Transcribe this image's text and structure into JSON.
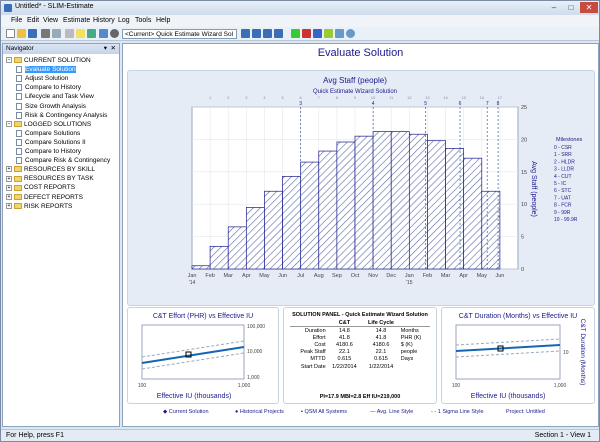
{
  "window": {
    "title": "Untitled* - SLIM-Estimate",
    "controls": [
      "–",
      "□",
      "✕"
    ]
  },
  "menu": [
    "File",
    "Edit",
    "View",
    "Estimate",
    "History",
    "Log",
    "Tools",
    "Help"
  ],
  "toolbar": {
    "combo_value": "<Current> Quick Estimate Wizard Sol"
  },
  "navigator": {
    "title": "Navigator",
    "head_icons": [
      "▾",
      "✕"
    ],
    "tree": [
      {
        "label": "CURRENT SOLUTION",
        "type": "folder",
        "level": 0,
        "expanded": true
      },
      {
        "label": "Evaluate Solution",
        "type": "doc",
        "level": 1,
        "selected": true
      },
      {
        "label": "Adjust Solution",
        "type": "doc",
        "level": 1
      },
      {
        "label": "Compare to History",
        "type": "doc",
        "level": 1
      },
      {
        "label": "Lifecycle and Task View",
        "type": "doc",
        "level": 1
      },
      {
        "label": "Size Growth Analysis",
        "type": "doc",
        "level": 1
      },
      {
        "label": "Risk & Contingency Analysis",
        "type": "doc",
        "level": 1
      },
      {
        "label": "LOGGED SOLUTIONS",
        "type": "folder",
        "level": 0,
        "expanded": true
      },
      {
        "label": "Compare Solutions",
        "type": "doc",
        "level": 1
      },
      {
        "label": "Compare Solutions II",
        "type": "doc",
        "level": 1
      },
      {
        "label": "Compare to History",
        "type": "doc",
        "level": 1
      },
      {
        "label": "Compare Risk & Contingency",
        "type": "doc",
        "level": 1
      },
      {
        "label": "RESOURCES BY SKILL",
        "type": "folder",
        "level": 0
      },
      {
        "label": "RESOURCES BY TASK",
        "type": "folder",
        "level": 0
      },
      {
        "label": "COST REPORTS",
        "type": "folder",
        "level": 0
      },
      {
        "label": "DEFECT REPORTS",
        "type": "folder",
        "level": 0
      },
      {
        "label": "RISK REPORTS",
        "type": "folder",
        "level": 0
      }
    ]
  },
  "main": {
    "title": "Evaluate Solution",
    "staff_chart": {
      "title": "Avg Staff (people)",
      "subtitle": "Quick Estimate Wizard Solution",
      "y_label": "Avg Staff (people)",
      "milestones_title": "Milestones",
      "milestones": [
        "0 - CSR",
        "1 - SRR",
        "2 - HLDR",
        "3 - LLDR",
        "4 - CUT",
        "5 - IC",
        "6 - STC",
        "7 - UAT",
        "8 - FCR",
        "9 - 99R",
        "10 - 99.9R"
      ],
      "milestone_markers": [
        {
          "label": "3",
          "x": 6.0
        },
        {
          "label": "4",
          "x": 10.0
        },
        {
          "label": "5",
          "x": 12.9
        },
        {
          "label": "6",
          "x": 14.8
        },
        {
          "label": "7",
          "x": 16.3
        },
        {
          "label": "8",
          "x": 16.9
        }
      ]
    },
    "effort_chart": {
      "title": "C&T Effort (PHR) vs Effective IU",
      "x_label": "Effective IU (thousands)",
      "x_ticks": [
        "100",
        "1,000"
      ],
      "y_ticks": [
        "100,000",
        "10,000",
        "1,000"
      ]
    },
    "duration_chart": {
      "title": "C&T Duration (Months) vs Effective IU",
      "x_label": "Effective IU (thousands)",
      "y_label": "C&T Duration (Months)",
      "x_ticks": [
        "100",
        "1,000"
      ],
      "y_ticks": [
        "10"
      ]
    },
    "solution_panel": {
      "title": "SOLUTION PANEL - Quick Estimate Wizard Solution",
      "headers": [
        "",
        "C&T",
        "Life Cycle",
        ""
      ],
      "rows": [
        [
          "Duration",
          "14.8",
          "14.8",
          "Months"
        ],
        [
          "Effort",
          "41.8",
          "41.8",
          "PHR (K)"
        ],
        [
          "Cost",
          "4180.6",
          "4180.6",
          "$ (K)"
        ],
        [
          "Peak Staff",
          "22.1",
          "22.1",
          "people"
        ],
        [
          "MTTD",
          "0.615",
          "0.615",
          "Days"
        ],
        [
          "Start Date",
          "1/22/2014",
          "1/22/2014",
          ""
        ]
      ],
      "footer": "PI=17.9   MBI=2.8   Eff IU=219,000"
    },
    "legend": [
      "Current Solution",
      "Historical Projects",
      "QSM All Systems",
      "Avg. Line Style",
      "1 Sigma Line Style",
      "Project: Untitled"
    ]
  },
  "status": {
    "left": "For Help, press F1",
    "right": "Section 1 - View 1"
  },
  "chart_data": [
    {
      "type": "bar",
      "title": "Avg Staff (people)",
      "subtitle": "Quick Estimate Wizard Solution",
      "ylabel": "Avg Staff (people)",
      "categories": [
        "Jan '14",
        "Feb",
        "Mar",
        "Apr",
        "May",
        "Jun",
        "Jul",
        "Aug",
        "Sep",
        "Oct",
        "Nov",
        "Dec",
        "Jan '15",
        "Feb",
        "Mar",
        "Apr",
        "May",
        "Jun"
      ],
      "x_ticks": [
        {
          "label": "Jan",
          "sub": "'14",
          "x": 0
        },
        {
          "label": "Feb",
          "x": 1
        },
        {
          "label": "Mar",
          "x": 2
        },
        {
          "label": "Apr",
          "x": 3
        },
        {
          "label": "May",
          "x": 4
        },
        {
          "label": "Jun",
          "x": 5
        },
        {
          "label": "Jul",
          "x": 6
        },
        {
          "label": "Aug",
          "x": 7
        },
        {
          "label": "Sep",
          "x": 8
        },
        {
          "label": "Oct",
          "x": 9
        },
        {
          "label": "Nov",
          "x": 10
        },
        {
          "label": "Dec",
          "x": 11
        },
        {
          "label": "Jan",
          "sub": "'15",
          "x": 12
        },
        {
          "label": "Feb",
          "x": 13
        },
        {
          "label": "Mar",
          "x": 14
        },
        {
          "label": "Apr",
          "x": 15
        },
        {
          "label": "May",
          "x": 16
        },
        {
          "label": "Jun",
          "x": 17
        }
      ],
      "top_ticks": [
        1,
        2,
        3,
        4,
        5,
        6,
        7,
        8,
        9,
        10,
        11,
        12,
        13,
        14,
        15,
        16,
        17
      ],
      "values": [
        0.5,
        3.5,
        6.5,
        9.5,
        12.0,
        14.3,
        16.5,
        18.2,
        19.6,
        20.5,
        21.2,
        21.2,
        20.8,
        19.8,
        18.6,
        17.1,
        12.0,
        0
      ],
      "ylim": [
        0,
        25
      ],
      "y_ticks": [
        0,
        5,
        10,
        15,
        20,
        25
      ],
      "xlim": [
        0,
        18
      ]
    }
  ]
}
